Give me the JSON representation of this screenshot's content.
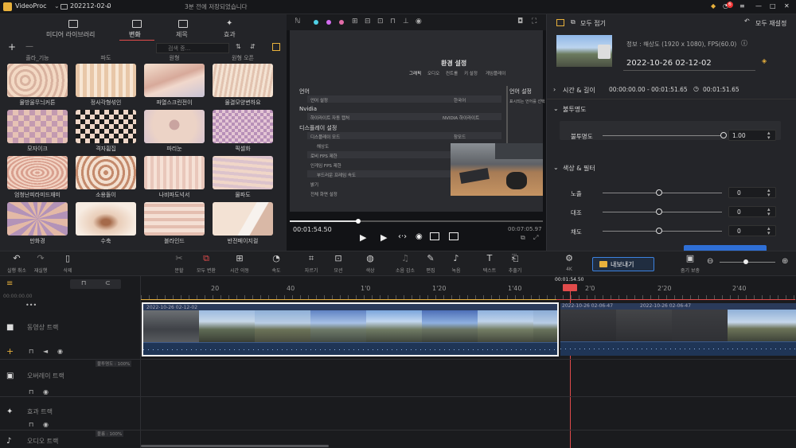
{
  "app": {
    "name": "VideoProc",
    "project": "202212-02-0",
    "save_status": "3분 전에 저장되었습니다",
    "badge": "6"
  },
  "left_tabs": [
    {
      "label": "미디어 라이브러리"
    },
    {
      "label": "변화"
    },
    {
      "label": "제목"
    },
    {
      "label": "효과"
    }
  ],
  "search": {
    "placeholder": "검색 중..."
  },
  "top_row_captions": [
    "줄라_기능",
    "파도",
    "원형",
    "원형 오픈"
  ],
  "transitions": [
    {
      "label": "물방울무늬커튼"
    },
    {
      "label": "정사각형섞인"
    },
    {
      "label": "파열스크린전이"
    },
    {
      "label": "물결모양변하요"
    },
    {
      "label": "모자이크"
    },
    {
      "label": "격자휨집"
    },
    {
      "label": "파리눈"
    },
    {
      "label": "픽셀화"
    },
    {
      "label": "엄청난피라미드재미"
    },
    {
      "label": "소용돌이"
    },
    {
      "label": "나비파도넉서"
    },
    {
      "label": "물파도"
    },
    {
      "label": "만화경"
    },
    {
      "label": "수축"
    },
    {
      "label": "블라인드"
    },
    {
      "label": "반전페이지컬"
    }
  ],
  "preview": {
    "settings_title": "환경 설정",
    "settings_tabs": [
      "그래픽",
      "오디오",
      "컨트롤",
      "키 설정",
      "게임플레이"
    ],
    "rows": [
      {
        "label": "언어",
        "value": ""
      },
      {
        "label": "언어 설정",
        "value": "한국어"
      },
      {
        "label": "Nvidia",
        "value": ""
      },
      {
        "label": "하이라이트 자동 캡처",
        "value": "NVIDIA 하이라이트"
      },
      {
        "label": "디스플레이 설정",
        "value": ""
      },
      {
        "label": "디스플레이 모드",
        "value": "창모드"
      },
      {
        "label": "해상도",
        "value": ""
      },
      {
        "label": "로비 FPS 제한",
        "value": ""
      },
      {
        "label": "인게임 FPS 제한",
        "value": ""
      },
      {
        "label": "부드러운 프레임 속도",
        "value": ""
      },
      {
        "label": "밝기",
        "value": ""
      },
      {
        "label": "전체 화면 설정",
        "value": ""
      }
    ],
    "side_title": "언어 설정",
    "side_desc": "표시되는 언어를 선택",
    "current_time": "00:01:54.50",
    "total_time": "00:07:05.97",
    "playhead_fraction": 0.27
  },
  "right": {
    "fold_all": "모두 접기",
    "reset_all": "모두 재설정",
    "info": "정보 : 해상도 (1920 x 1080), FPS(60.0)",
    "clip_name": "2022-10-26 02-12-02",
    "time_section": "시간 & 길이",
    "time_range": "00:00:00.00 - 00:01:51.65",
    "duration": "00:01:51.65",
    "opacity_section": "불투명도",
    "opacity_label": "불투명도",
    "opacity_value": "1.00",
    "color_section": "색상 & 필터",
    "exposure_label": "노출",
    "exposure_value": "0",
    "contrast_label": "대조",
    "contrast_value": "0",
    "saturation_label": "채도",
    "saturation_value": "0"
  },
  "toolbar": {
    "undo": "실행 취소",
    "redo": "재실행",
    "delete": "삭제",
    "split": "분할",
    "all_transitions": "모두 변환",
    "time_move": "시간 이동",
    "speed": "속도",
    "crop": "자르기",
    "motion": "모션",
    "color": "색상",
    "denoise": "소음 감소",
    "edit": "편집",
    "record": "녹음",
    "text": "텍스트",
    "extract": "추출기",
    "fourk": "4K",
    "export": "내보내기",
    "fit": "줌기 보충"
  },
  "timeline": {
    "ruler_start": "00:00:00.00",
    "tick_labels": [
      "20",
      "40",
      "1'0",
      "1'20",
      "1'40",
      "2'0",
      "2'20",
      "2'40"
    ],
    "playhead_time": "00:01:54.50",
    "video_track": "동영상 트랙",
    "overlay_track": "오버레이 트랙",
    "effect_track": "효과 트랙",
    "audio_track": "오디오 트랙",
    "overlay_volume": "불투명도 : 100%",
    "audio_volume": "볼륨 : 100%",
    "clip1_name": "2022-10-26 02-12-02",
    "clip2_name": "2022-10-26 02-06-47",
    "clip3_name": "2022-10-26 02-06-47"
  }
}
